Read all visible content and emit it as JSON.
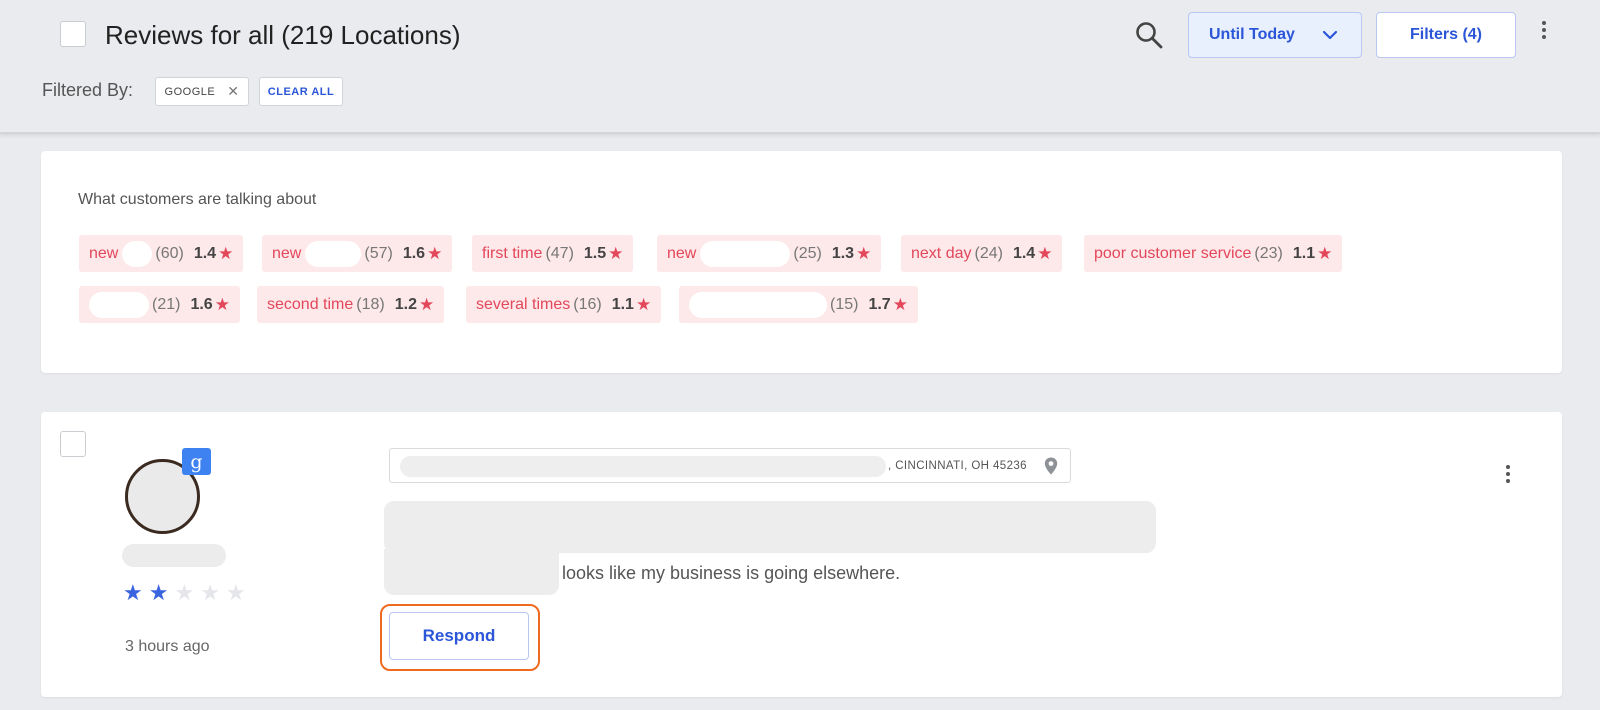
{
  "header": {
    "title": "Reviews for all (219 Locations)",
    "date_label": "Until Today",
    "filters_label": "Filters (4)",
    "filtered_by_label": "Filtered By:",
    "active_filter": "GOOGLE",
    "clear_all_label": "CLEAR ALL"
  },
  "topics": {
    "title": "What customers are talking about",
    "tags": [
      {
        "label": "new",
        "count": "(60)",
        "rating": "1.4"
      },
      {
        "label": "new",
        "count": "(57)",
        "rating": "1.6"
      },
      {
        "label": "first time",
        "count": "(47)",
        "rating": "1.5"
      },
      {
        "label": "new",
        "count": "(25)",
        "rating": "1.3"
      },
      {
        "label": "next day",
        "count": "(24)",
        "rating": "1.4"
      },
      {
        "label": "poor customer service",
        "count": "(23)",
        "rating": "1.1"
      },
      {
        "label": "",
        "count": "(21)",
        "rating": "1.6"
      },
      {
        "label": "second time",
        "count": "(18)",
        "rating": "1.2"
      },
      {
        "label": "several times",
        "count": "(16)",
        "rating": "1.1"
      },
      {
        "label": "",
        "count": "(15)",
        "rating": "1.7"
      }
    ]
  },
  "review": {
    "location_suffix": ", CINCINNATI, OH 45236",
    "text_visible": "looks like my business is going elsewhere.",
    "rating": 2,
    "max_rating": 5,
    "time_ago": "3 hours ago",
    "respond_label": "Respond",
    "source_badge": "g"
  },
  "icons": {
    "search": "search-icon",
    "dropdown": "chevron-down-icon",
    "more": "more-vertical-icon",
    "remove_filter": "close-icon",
    "location": "map-pin-icon",
    "star": "star-icon",
    "source": "google-icon"
  },
  "colors": {
    "accent": "#2b56d8",
    "tag_bg": "#fde8ea",
    "tag_text": "#e3475a",
    "star_filled": "#3a63e0",
    "star_empty": "#e5e6ea",
    "highlight": "#ee6a1f",
    "google_badge": "#3d82f0"
  }
}
